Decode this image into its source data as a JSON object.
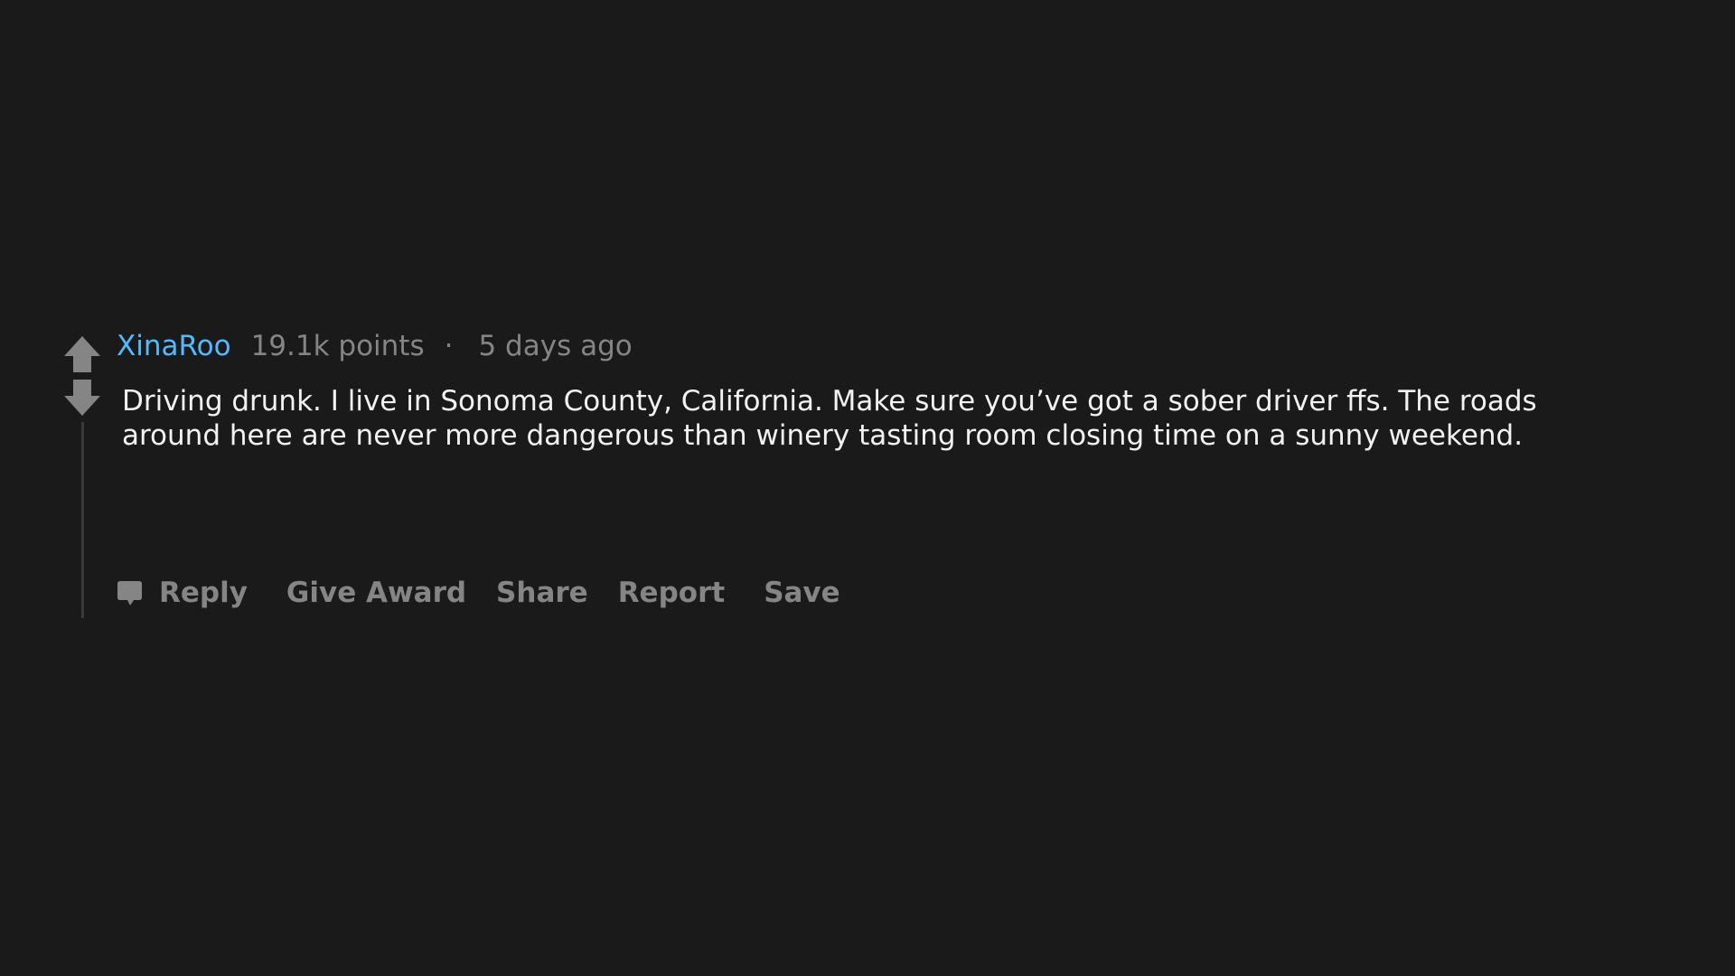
{
  "colors": {
    "background": "#1a1a1a",
    "author": "#4fbcff",
    "meta_text": "#858585",
    "body_text": "#f2f2f2",
    "vote_arrow": "#858585",
    "thread_line": "#3a3a3a"
  },
  "icons": {
    "upvote": "arrow-up-icon",
    "downvote": "arrow-down-icon",
    "reply": "comment-bubble-icon"
  },
  "comment": {
    "author": "XinaRoo",
    "points": "19.1k points",
    "separator": "·",
    "age": "5 days ago",
    "body": "Driving drunk. I live in Sonoma County, California. Make sure you’ve got a sober driver ffs. The roads around here are never more dangerous than winery tasting room closing time on a sunny weekend."
  },
  "actions": {
    "reply": "Reply",
    "give_award": "Give Award",
    "share": "Share",
    "report": "Report",
    "save": "Save"
  }
}
